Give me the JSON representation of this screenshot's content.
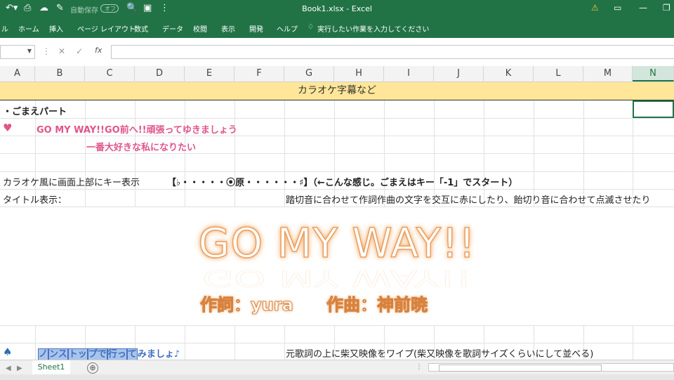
{
  "titlebar": {
    "autosave_label": "自動保存",
    "autosave_state": "オフ",
    "document_title": "Book1.xlsx - Excel"
  },
  "ribbon": {
    "tabs": [
      "ル",
      "ホーム",
      "挿入",
      "ページ レイアウト",
      "数式",
      "データ",
      "校閲",
      "表示",
      "開発",
      "ヘルプ"
    ],
    "tell_me": "実行したい作業を入力してください"
  },
  "formula_bar": {
    "fx": "fx",
    "value": ""
  },
  "columns": [
    "A",
    "B",
    "C",
    "D",
    "E",
    "F",
    "G",
    "H",
    "I",
    "J",
    "K",
    "L",
    "M",
    "N"
  ],
  "selected_column": "N",
  "sheet": {
    "banner": "カラオケ字幕など",
    "section_heading": "・ごまえパート",
    "heart_symbol": "♥",
    "lyric_line1": "GO MY WAY!!GO前へ!!頑張ってゆきましょう",
    "lyric_line2": "一番大好きな私になりたい",
    "key_display_label": "カラオケ風に画面上部にキー表示",
    "key_display_value": "【♭・・・・・⦿原・・・・・・♯】（←こんな感じ。ごまえはキー「-1」でスタート）",
    "title_display_label": "タイトル表示：",
    "title_display_note": "踏切音に合わせて作詞作曲の文字を交互に赤にしたり、飴切り音に合わせて点滅させたり",
    "song_title": "GO MY WAY!!",
    "lyricist": "作詞：yura",
    "composer": "作曲：神前暁",
    "spade_symbol": "♠",
    "lyric_hl_1": "ノ",
    "lyric_hl_2": "ンス",
    "lyric_hl_3": "トッ",
    "lyric_hl_4": "プで",
    "lyric_hl_5": "行っ",
    "lyric_hl_6": "て",
    "lyric_rest": "みましょ♪",
    "wipe_note": "元歌詞の上に柴又映像をワイプ(柴又映像を歌詞サイズくらいにして並べる)"
  },
  "status": {
    "sheet_tab": "Sheet1",
    "add_sheet": "⊕"
  },
  "colors": {
    "excel_green": "#217346",
    "banner_yellow": "#ffe699",
    "lyric_pink": "#e0558a",
    "highlight_blue": "#a8c4ec"
  }
}
